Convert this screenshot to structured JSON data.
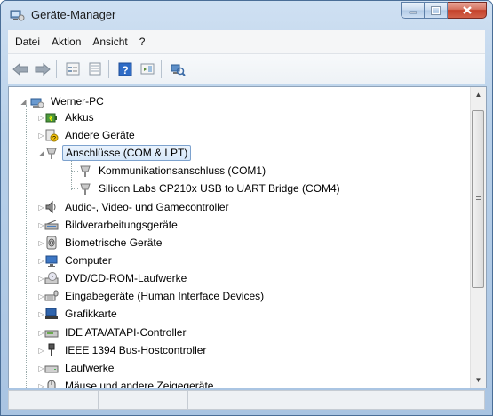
{
  "window": {
    "title": "Geräte-Manager"
  },
  "menu": {
    "items": [
      "Datei",
      "Aktion",
      "Ansicht",
      "?"
    ]
  },
  "toolbar": {
    "buttons": [
      "back-icon",
      "forward-icon",
      "properties-icon",
      "list-view-icon",
      "help-icon",
      "expand-view-icon",
      "scan-hardware-icon"
    ]
  },
  "tree": {
    "root": "Werner-PC",
    "items": [
      {
        "label": "Akkus",
        "icon": "battery-icon"
      },
      {
        "label": "Andere Geräte",
        "icon": "unknown-device-icon"
      },
      {
        "label": "Anschlüsse (COM & LPT)",
        "icon": "port-icon",
        "expanded": true,
        "selected": true,
        "children": [
          {
            "label": "Kommunikationsanschluss (COM1)",
            "icon": "port-icon"
          },
          {
            "label": "Silicon Labs CP210x USB to UART Bridge (COM4)",
            "icon": "port-icon"
          }
        ]
      },
      {
        "label": "Audio-, Video- und Gamecontroller",
        "icon": "speaker-icon"
      },
      {
        "label": "Bildverarbeitungsgeräte",
        "icon": "scanner-icon"
      },
      {
        "label": "Biometrische Geräte",
        "icon": "fingerprint-icon"
      },
      {
        "label": "Computer",
        "icon": "computer-icon"
      },
      {
        "label": "DVD/CD-ROM-Laufwerke",
        "icon": "dvd-drive-icon"
      },
      {
        "label": "Eingabegeräte (Human Interface Devices)",
        "icon": "hid-icon"
      },
      {
        "label": "Grafikkarte",
        "icon": "display-adapter-icon"
      },
      {
        "label": "IDE ATA/ATAPI-Controller",
        "icon": "ide-controller-icon"
      },
      {
        "label": "IEEE 1394 Bus-Hostcontroller",
        "icon": "firewire-icon"
      },
      {
        "label": "Laufwerke",
        "icon": "disk-drive-icon"
      },
      {
        "label": "Mäuse und andere Zeigegeräte",
        "icon": "mouse-icon"
      }
    ]
  },
  "colors": {
    "selection_border": "#7da2ce",
    "selection_fill": "#d6e7f9",
    "window_frame": "#a9c4e2",
    "close_button": "#c4412a"
  }
}
